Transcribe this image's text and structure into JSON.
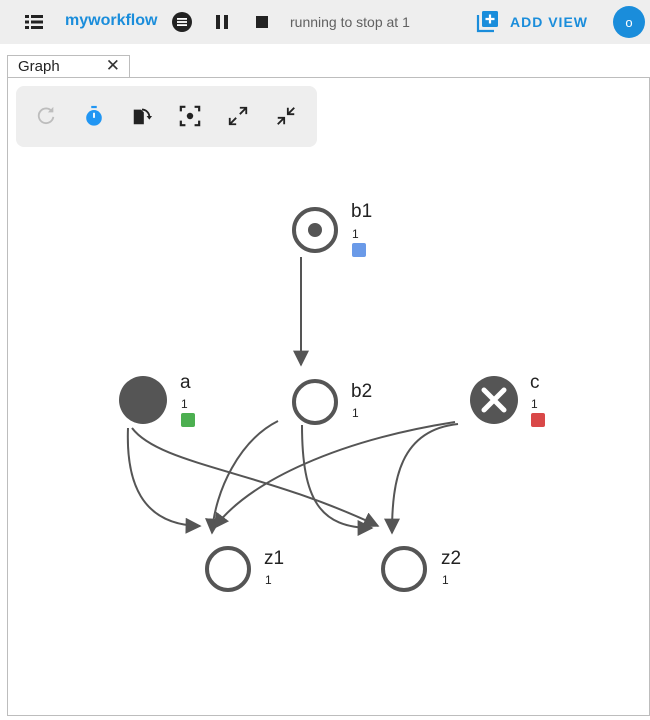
{
  "header": {
    "workflow_name": "myworkflow",
    "status_message": "running to stop at 1",
    "add_view_label": "ADD VIEW",
    "user_initial": "o",
    "icons": [
      "menu-icon",
      "hold-icon",
      "pause-icon",
      "stop-icon",
      "add-view-icon"
    ]
  },
  "tab": {
    "label": "Graph",
    "close_glyph": "✕"
  },
  "toolbar": {
    "buttons": [
      "refresh-icon",
      "timer-icon",
      "transpose-icon",
      "center-icon",
      "expand-icon",
      "collapse-icon"
    ]
  },
  "graph": {
    "nodes": {
      "b1": {
        "name": "b1",
        "cycle": "1",
        "state": "submitted",
        "status_color": "#6a9ae8"
      },
      "a": {
        "name": "a",
        "cycle": "1",
        "state": "succeeded",
        "status_color": "#4caf50"
      },
      "b2": {
        "name": "b2",
        "cycle": "1",
        "state": "waiting",
        "status_color": ""
      },
      "c": {
        "name": "c",
        "cycle": "1",
        "state": "failed",
        "status_color": "#d94848"
      },
      "z1": {
        "name": "z1",
        "cycle": "1",
        "state": "waiting",
        "status_color": ""
      },
      "z2": {
        "name": "z2",
        "cycle": "1",
        "state": "waiting",
        "status_color": ""
      }
    },
    "edges": [
      [
        "b1",
        "b2"
      ],
      [
        "a",
        "z1"
      ],
      [
        "a",
        "z2"
      ],
      [
        "b2",
        "z1"
      ],
      [
        "b2",
        "z2"
      ],
      [
        "c",
        "z1"
      ],
      [
        "c",
        "z2"
      ]
    ]
  },
  "colors": {
    "accent": "#1a8ddb",
    "node_stroke": "#555555",
    "toolbar_bg": "#eeeeee"
  }
}
